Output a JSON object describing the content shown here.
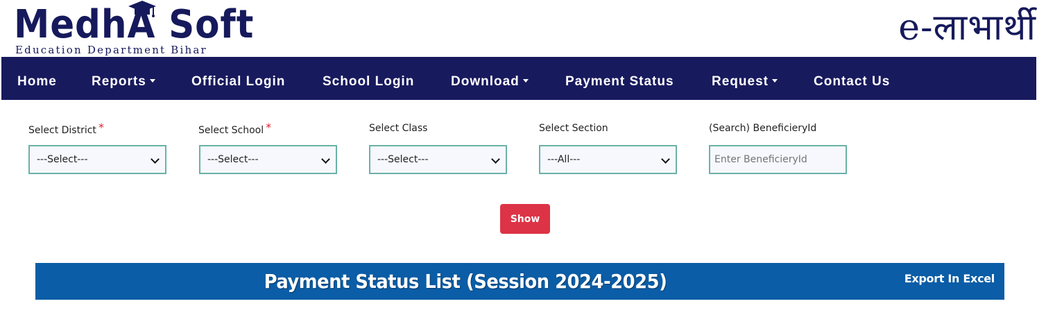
{
  "header": {
    "logo_main": "MedhA Soft",
    "logo_sub": "Education Department Bihar",
    "brand_right": "e-लाभार्थी"
  },
  "nav": {
    "items": [
      {
        "label": "Home",
        "dropdown": false
      },
      {
        "label": "Reports",
        "dropdown": true
      },
      {
        "label": "Official Login",
        "dropdown": false
      },
      {
        "label": "School Login",
        "dropdown": false
      },
      {
        "label": "Download",
        "dropdown": true
      },
      {
        "label": "Payment Status",
        "dropdown": false
      },
      {
        "label": "Request",
        "dropdown": true
      },
      {
        "label": "Contact Us",
        "dropdown": false
      }
    ]
  },
  "filters": {
    "district": {
      "label": "Select District",
      "required_mark": "*",
      "value": "---Select---"
    },
    "school": {
      "label": "Select School",
      "required_mark": "*",
      "value": "---Select---"
    },
    "class": {
      "label": "Select Class",
      "value": "---Select---"
    },
    "section": {
      "label": "Select Section",
      "value": "---All---"
    },
    "beneficiary": {
      "label": "(Search) BeneficieryId",
      "placeholder": "Enter BeneficieryId",
      "value": ""
    }
  },
  "actions": {
    "show_label": "Show"
  },
  "list": {
    "title": "Payment Status List (Session 2024-2025)",
    "export_label": "Export In Excel"
  },
  "colors": {
    "navbar": "#181a5e",
    "brand": "#161a5c",
    "accent_button": "#dd3346",
    "title_bar": "#0a5da6",
    "input_border": "#6ab1a6",
    "required": "#e01e2a"
  }
}
